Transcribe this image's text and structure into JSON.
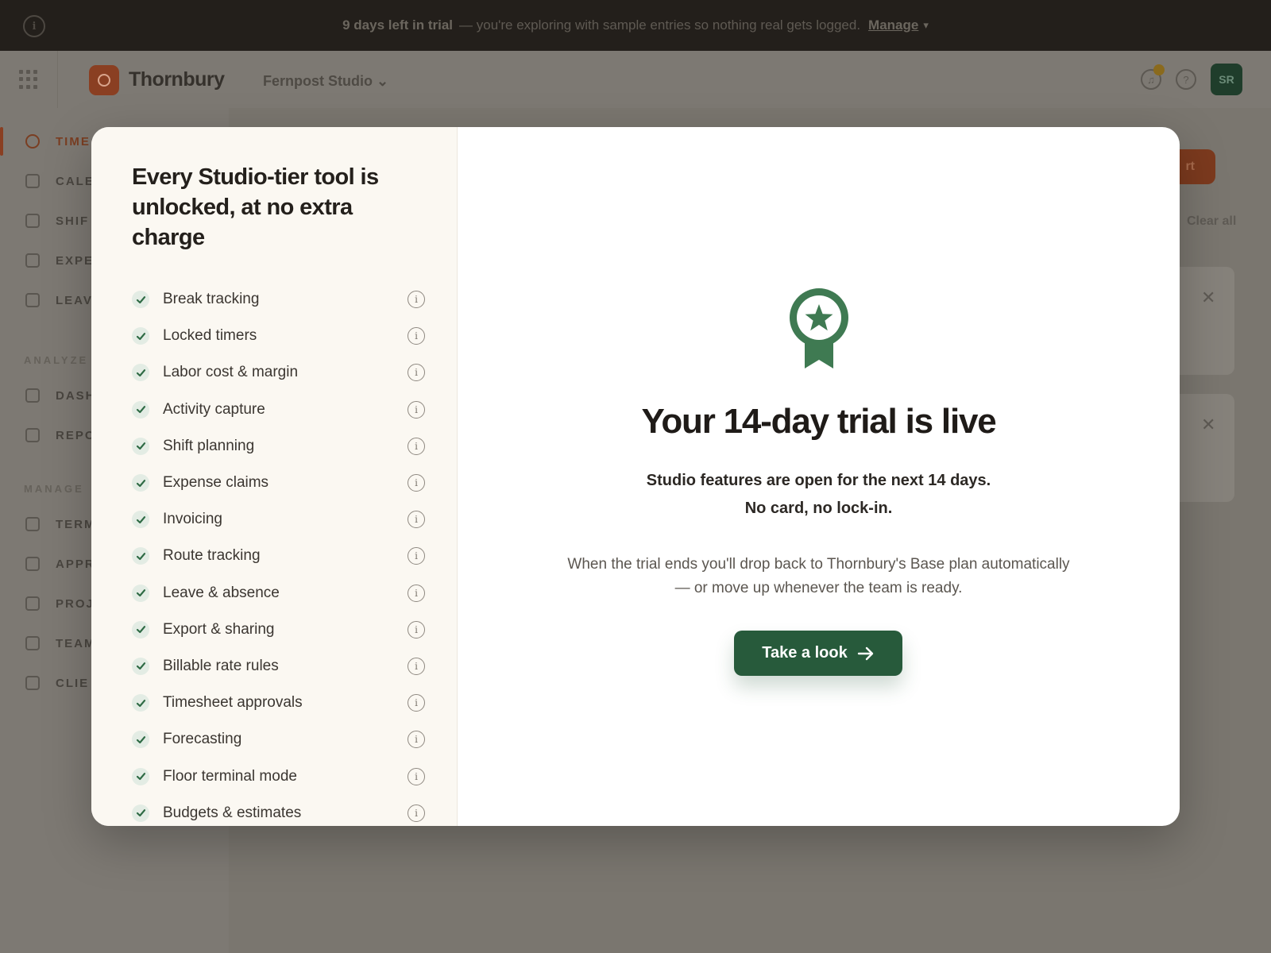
{
  "banner": {
    "days_left": "9 days left in trial",
    "message": "— you're exploring with sample entries so nothing real gets logged.",
    "manage_label": "Manage"
  },
  "header": {
    "brand": "Thornbury",
    "workspace": "Fernpost Studio",
    "avatar_initials": "SR"
  },
  "sidebar": {
    "items": [
      {
        "label": "TIME",
        "icon": "clock-icon"
      },
      {
        "label": "CALE",
        "icon": "calendar-icon"
      },
      {
        "label": "SHIF",
        "icon": "shift-icon"
      },
      {
        "label": "EXPE",
        "icon": "receipt-icon"
      },
      {
        "label": "LEAV",
        "icon": "leave-icon"
      }
    ],
    "analyze_heading": "ANALYZE",
    "analyze_items": [
      {
        "label": "DASH",
        "icon": "dashboard-icon"
      },
      {
        "label": "REPO",
        "icon": "bar-chart-icon"
      }
    ],
    "manage_heading": "MANAGE",
    "manage_items": [
      {
        "label": "TERM",
        "icon": "terminal-icon"
      },
      {
        "label": "APPR",
        "icon": "check-icon"
      },
      {
        "label": "PROJ",
        "icon": "project-icon"
      },
      {
        "label": "TEAM",
        "icon": "team-icon"
      },
      {
        "label": "CLIE",
        "icon": "client-icon"
      }
    ]
  },
  "background": {
    "action_button": "rt",
    "clear_all": "Clear all"
  },
  "modal": {
    "left_title": "Every Studio-tier tool is unlocked, at no extra charge",
    "features": [
      "Break tracking",
      "Locked timers",
      "Labor cost & margin",
      "Activity capture",
      "Shift planning",
      "Expense claims",
      "Invoicing",
      "Route tracking",
      "Leave & absence",
      "Export & sharing",
      "Billable rate rules",
      "Timesheet approvals",
      "Forecasting",
      "Floor terminal mode",
      "Budgets & estimates"
    ],
    "title": "Your 14-day trial is live",
    "subtitle_line1": "Studio features are open for the next 14 days.",
    "subtitle_line2": "No card, no lock-in.",
    "note_line1": "When the trial ends you'll drop back to Thornbury's Base plan automatically",
    "note_line2": "— or move up whenever the team is ready.",
    "cta_label": "Take a look",
    "accent_color": "#275a3b",
    "ribbon_color": "#3f7a52"
  }
}
